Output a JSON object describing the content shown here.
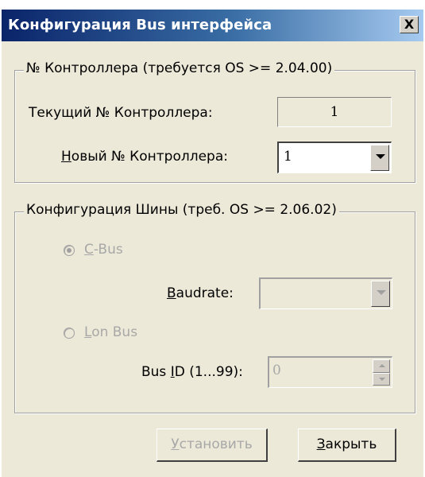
{
  "window": {
    "title": "Конфигурация Bus интерфейса",
    "close_glyph": "X"
  },
  "controller_group": {
    "legend": "№ Контроллера (требуется OS >= 2.04.00)",
    "current_label": "Текущий № Контроллера:",
    "current_value": "1",
    "new_label_accel": "Н",
    "new_label_rest": "овый № Контроллера:",
    "new_value": "1"
  },
  "bus_group": {
    "legend": "Конфигурация Шины (треб. OS >= 2.06.02)",
    "cbus_accel": "C",
    "cbus_rest": "-Bus",
    "cbus_selected": true,
    "baudrate_accel": "B",
    "baudrate_rest": "audrate:",
    "baudrate_value": "",
    "lonbus_accel": "L",
    "lonbus_rest": "on Bus",
    "lonbus_selected": false,
    "busid_pre": "Bus ",
    "busid_accel": "I",
    "busid_rest": "D (1...99):",
    "busid_value": "0"
  },
  "buttons": {
    "install_accel": "У",
    "install_rest": "становить",
    "install_enabled": false,
    "close_accel": "З",
    "close_rest": "акрыть",
    "close_enabled": true
  }
}
